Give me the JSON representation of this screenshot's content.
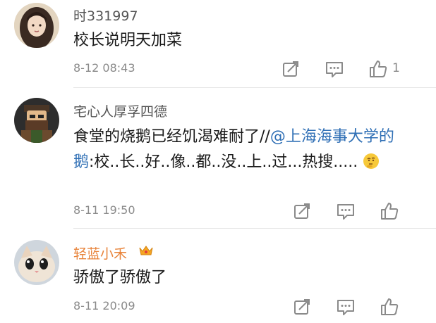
{
  "comments": [
    {
      "username": "时331997",
      "text": "校长说明天加菜",
      "time": "8-12 08:43",
      "likes": "1",
      "avatar_icon": "avatar-girl-long-hair",
      "actions": [
        "forward-icon",
        "comment-icon",
        "like-icon"
      ]
    },
    {
      "username": "宅心人厚孚四德",
      "text_before": "食堂的烧鹅已经饥渴难耐了//",
      "mention": "@上海海事大学的鹅",
      "text_after": ":校..长..好..像..都..没..上..过...热搜.....",
      "emoji": "thinking-face-emoji",
      "time": "8-11 19:50",
      "avatar_icon": "avatar-lego-character",
      "actions": [
        "forward-icon",
        "comment-icon",
        "like-icon"
      ]
    },
    {
      "username": "轻蓝小禾",
      "badge": "vip-crown-icon",
      "text": "骄傲了骄傲了",
      "time": "8-11 20:09",
      "avatar_icon": "avatar-kitten",
      "actions": [
        "forward-icon",
        "comment-icon",
        "like-icon"
      ]
    }
  ],
  "colors": {
    "username": "#555555",
    "vip_username": "#e8833a",
    "mention": "#2f6fb5",
    "meta": "#8a8a8a"
  }
}
